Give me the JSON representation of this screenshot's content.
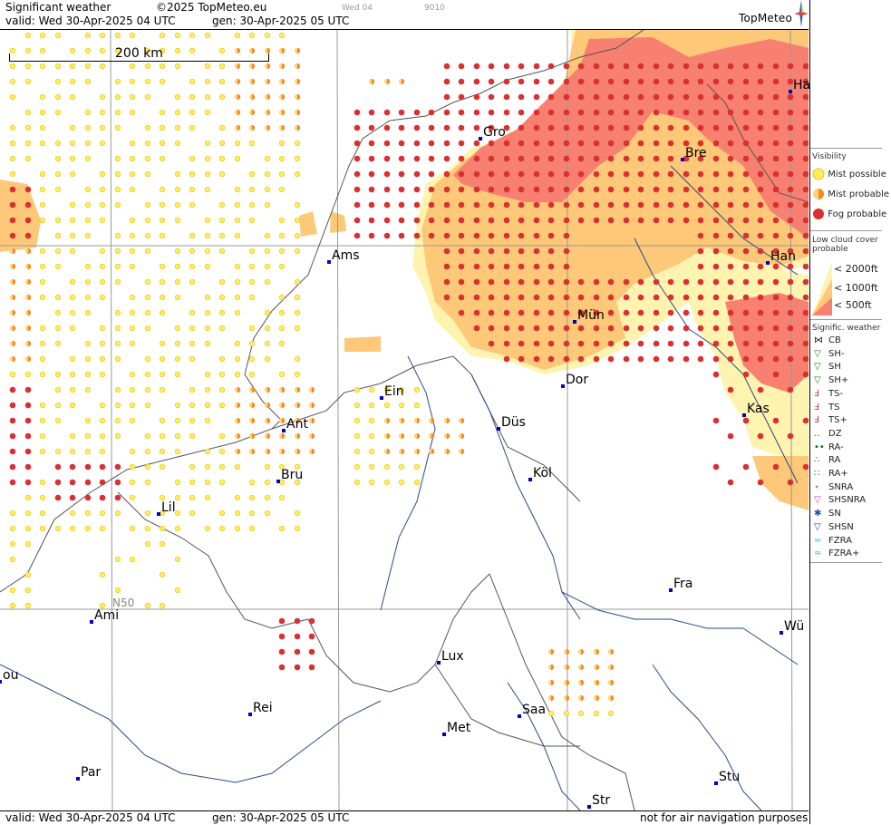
{
  "header": {
    "title": "Significant weather",
    "copyright": "©2025 TopMeteo.eu",
    "valid_line": "valid:  Wed  30-Apr-2025  04 UTC",
    "gen_line": "gen: 30-Apr-2025 05 UTC",
    "faint_left": "Wed 04",
    "faint_right": "9010",
    "logo": "TopMeteo"
  },
  "footer": {
    "valid_line": "valid:  Wed  30-Apr-2025  04 UTC",
    "gen_line": "gen: 30-Apr-2025 05 UTC",
    "disclaimer": "not for air navigation purposes"
  },
  "map": {
    "scale_label": "200 km",
    "lat_label": "N50",
    "cities": [
      {
        "name": "Gro",
        "id": "gro"
      },
      {
        "name": "Bre",
        "id": "bre"
      },
      {
        "name": "Ha",
        "id": "ha"
      },
      {
        "name": "Ams",
        "id": "ams"
      },
      {
        "name": "Han",
        "id": "han"
      },
      {
        "name": "Mün",
        "id": "mun"
      },
      {
        "name": "Dor",
        "id": "dor"
      },
      {
        "name": "Ein",
        "id": "ein"
      },
      {
        "name": "Ant",
        "id": "ant"
      },
      {
        "name": "Düs",
        "id": "dus"
      },
      {
        "name": "Kas",
        "id": "kas"
      },
      {
        "name": "Bru",
        "id": "bru"
      },
      {
        "name": "Köl",
        "id": "kol"
      },
      {
        "name": "Lil",
        "id": "lil"
      },
      {
        "name": "Fra",
        "id": "fra"
      },
      {
        "name": "Ami",
        "id": "ami"
      },
      {
        "name": "Wü",
        "id": "wu"
      },
      {
        "name": "Lux",
        "id": "lux"
      },
      {
        "name": "ou",
        "id": "ou"
      },
      {
        "name": "Rei",
        "id": "rei"
      },
      {
        "name": "Saa",
        "id": "saa"
      },
      {
        "name": "Met",
        "id": "met"
      },
      {
        "name": "Par",
        "id": "par"
      },
      {
        "name": "Stu",
        "id": "stu"
      },
      {
        "name": "Str",
        "id": "str"
      }
    ]
  },
  "legend": {
    "visibility_title": "Visibility",
    "visibility_items": [
      "Mist possible",
      "Mist probable",
      "Fog probable"
    ],
    "lowcloud_title": "Low cloud cover probable",
    "lowcloud_items": [
      "< 2000ft",
      "< 1000ft",
      "<   500ft"
    ],
    "sigwx_title": "Signific. weather",
    "sigwx_items": [
      "CB",
      "SH-",
      "SH",
      "SH+",
      "TS-",
      "TS",
      "TS+",
      "DZ",
      "RA-",
      "RA",
      "RA+",
      "SNRA",
      "SHSNRA",
      "SN",
      "SHSN",
      "FZRA",
      "FZRA+"
    ]
  },
  "colors": {
    "mist_possible": "#ffee55",
    "mist_probable": "#f58a1e",
    "fog_probable": "#d93030",
    "cloud_2000": "#fff3b0",
    "cloud_1000": "#fdc878",
    "cloud_500": "#f88070",
    "city_marker": "#0000cc",
    "logo": "#2a5fa6"
  }
}
